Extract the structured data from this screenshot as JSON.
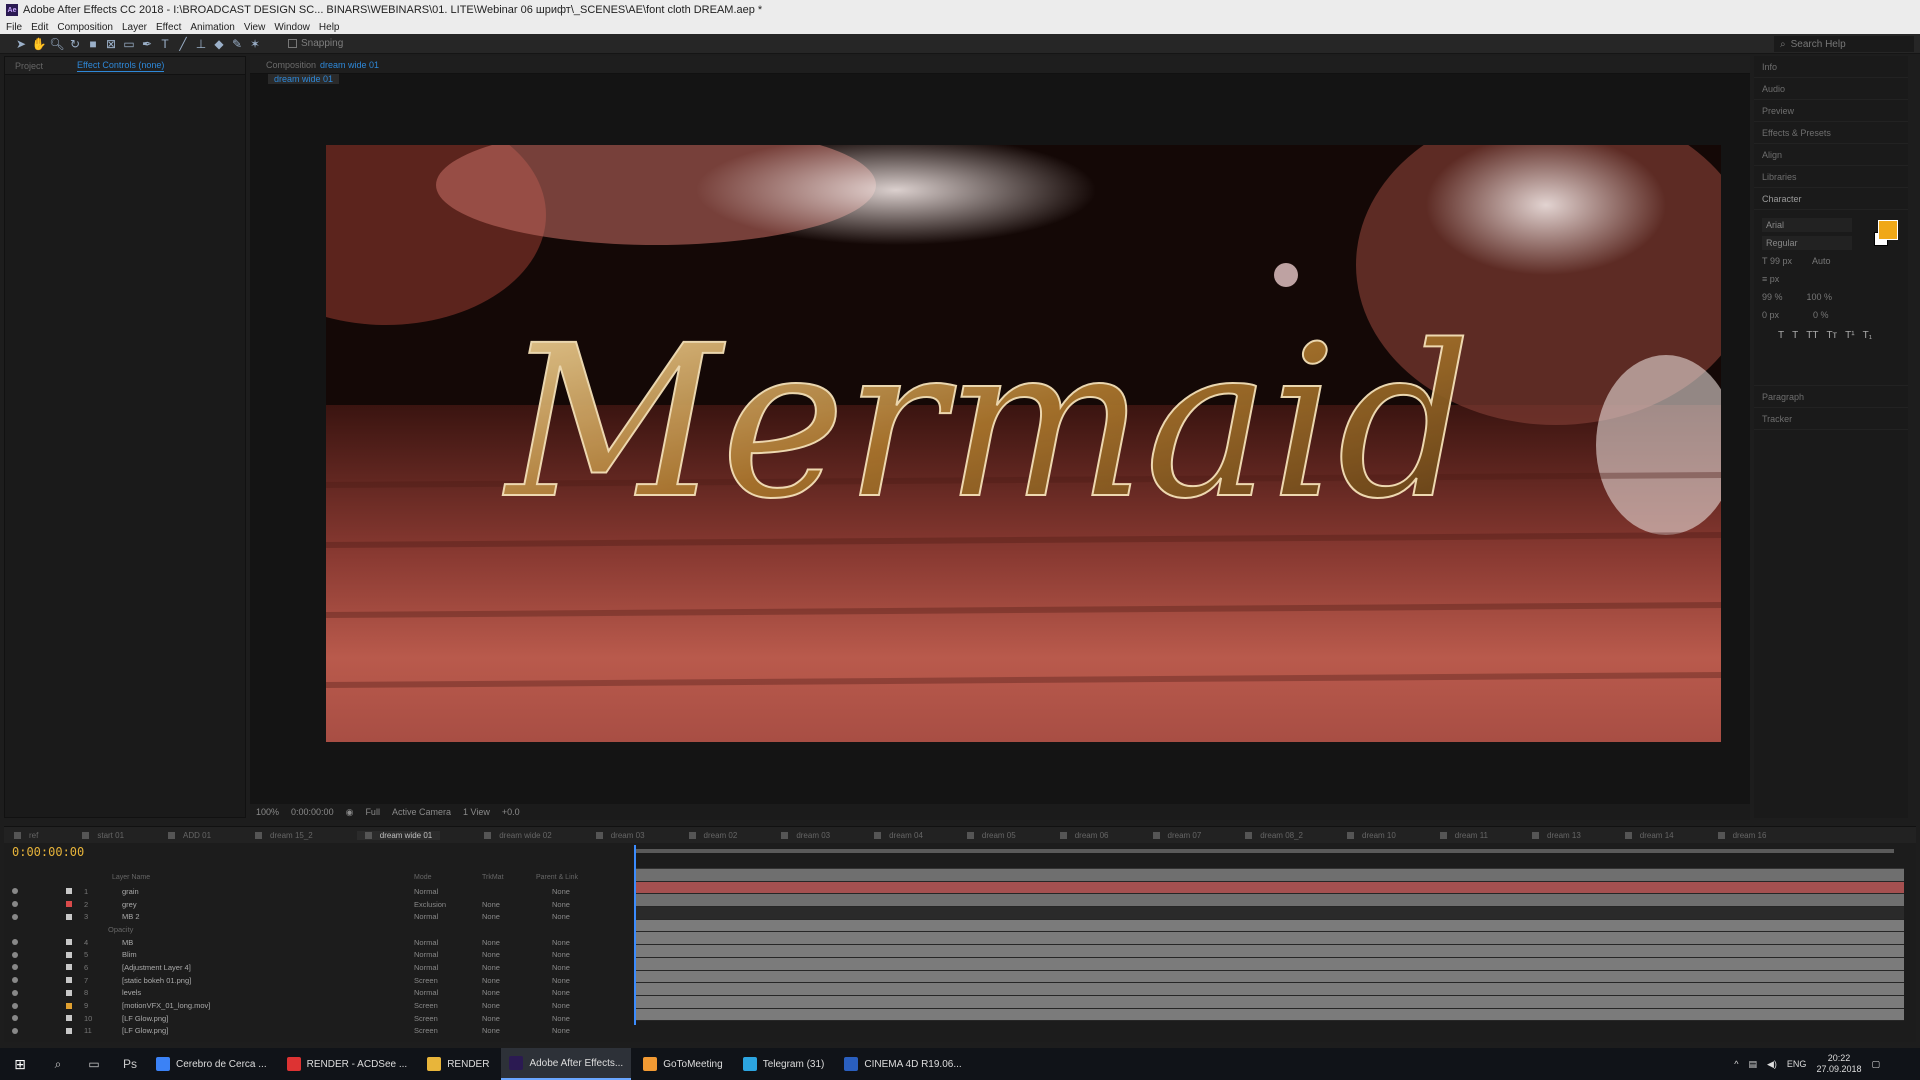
{
  "window": {
    "title": "Adobe After Effects CC 2018 - I:\\BROADCAST DESIGN SC... BINARS\\WEBINARS\\01. LITE\\Webinar 06 шрифт\\_SCENES\\AE\\font cloth DREAM.aep *",
    "app_badge": "Ae"
  },
  "menu": [
    "File",
    "Edit",
    "Composition",
    "Layer",
    "Effect",
    "Animation",
    "View",
    "Window",
    "Help"
  ],
  "toolbar": {
    "snapping_label": "Snapping",
    "search_placeholder": "Search Help"
  },
  "left_panel": {
    "tab_project": "Project",
    "tab_effect_controls": "Effect Controls (none)"
  },
  "comp_panel": {
    "header_prefix": "Composition",
    "header_name": "dream wide 01",
    "sub_tab": "dream wide 01"
  },
  "comp_controls": {
    "zoom": "100%",
    "timecode": "0:00:00:00",
    "resolution": "Full",
    "camera": "Active Camera",
    "views": "1 View",
    "exposure": "+0.0"
  },
  "right_panel": {
    "items_top": [
      "Info",
      "Audio",
      "Preview",
      "Effects & Presets",
      "Align",
      "Libraries"
    ],
    "character_title": "Character",
    "font_family": "Arial",
    "font_style": "Regular",
    "font_size": "99 px",
    "leading": "Auto",
    "stroke_unit": "px",
    "vertical_scale": "99 %",
    "horizontal_scale": "100 %",
    "baseline": "0 px",
    "tsume": "0 %",
    "format_buttons": [
      "T",
      "T",
      "TT",
      "Tт",
      "T¹",
      "T₁"
    ],
    "items_bottom": [
      "Paragraph",
      "Tracker"
    ],
    "fill_color": "#f0a818"
  },
  "timeline": {
    "current_time": "0:00:00:00",
    "tabs": [
      "ref",
      "start 01",
      "ADD 01",
      "dream 15_2",
      "dream wide 01",
      "dream wide 02",
      "dream 03",
      "dream 02",
      "dream 03",
      "dream 04",
      "dream 05",
      "dream 06",
      "dream 07",
      "dream 08_2",
      "dream 10",
      "dream 11",
      "dream 13",
      "dream 14",
      "dream 16"
    ],
    "active_tab_index": 4,
    "column_headers": {
      "layer_name": "Layer Name",
      "mode": "Mode",
      "trkmat": "TrkMat",
      "parent": "Parent & Link"
    },
    "layers": [
      {
        "num": "1",
        "name": "grain",
        "mode": "Normal",
        "trkmat": "",
        "parent": "None",
        "color": "#c8c8c8"
      },
      {
        "num": "2",
        "name": "grey",
        "mode": "Exclusion",
        "trkmat": "None",
        "parent": "None",
        "color": "#d94a4a"
      },
      {
        "num": "3",
        "name": "MB 2",
        "mode": "Normal",
        "trkmat": "None",
        "parent": "None",
        "color": "#c8c8c8"
      },
      {
        "num": "",
        "name": "Opacity",
        "mode": "",
        "trkmat": "",
        "parent": "",
        "color": ""
      },
      {
        "num": "4",
        "name": "MB",
        "mode": "Normal",
        "trkmat": "None",
        "parent": "None",
        "color": "#c8c8c8"
      },
      {
        "num": "5",
        "name": "Blim",
        "mode": "Normal",
        "trkmat": "None",
        "parent": "None",
        "color": "#c8c8c8"
      },
      {
        "num": "6",
        "name": "[Adjustment Layer 4]",
        "mode": "Normal",
        "trkmat": "None",
        "parent": "None",
        "color": "#c8c8c8"
      },
      {
        "num": "7",
        "name": "[static bokeh 01.png]",
        "mode": "Screen",
        "trkmat": "None",
        "parent": "None",
        "color": "#c8c8c8"
      },
      {
        "num": "8",
        "name": "levels",
        "mode": "Normal",
        "trkmat": "None",
        "parent": "None",
        "color": "#c8c8c8"
      },
      {
        "num": "9",
        "name": "[motionVFX_01_long.mov]",
        "mode": "Screen",
        "trkmat": "None",
        "parent": "None",
        "color": "#e0a030"
      },
      {
        "num": "10",
        "name": "[LF Glow.png]",
        "mode": "Screen",
        "trkmat": "None",
        "parent": "None",
        "color": "#c8c8c8"
      },
      {
        "num": "11",
        "name": "[LF Glow.png]",
        "mode": "Screen",
        "trkmat": "None",
        "parent": "None",
        "color": "#c8c8c8"
      }
    ],
    "track_colors": [
      "#6f6f6f",
      "#a55050",
      "#6f6f6f",
      "#2a2a2a",
      "#7b7b7b",
      "#7b7b7b",
      "#7b7b7b",
      "#7b7b7b",
      "#7b7b7b",
      "#7b7b7b",
      "#7b7b7b",
      "#7b7b7b"
    ]
  },
  "taskbar": {
    "apps": [
      {
        "label": "Cerebro de Cerca ...",
        "color": "#3b82f6"
      },
      {
        "label": "RENDER - ACDSee ...",
        "color": "#d33"
      },
      {
        "label": "RENDER",
        "color": "#e8b53a"
      },
      {
        "label": "Adobe After Effects...",
        "color": "#2b1a52"
      },
      {
        "label": "GoToMeeting",
        "color": "#f29a33"
      },
      {
        "label": "Telegram (31)",
        "color": "#2ca5e0"
      },
      {
        "label": "CINEMA 4D R19.06...",
        "color": "#2a5fbf"
      }
    ],
    "active_index": 3,
    "lang": "ENG",
    "time": "20:22",
    "date": "27.09.2018"
  }
}
